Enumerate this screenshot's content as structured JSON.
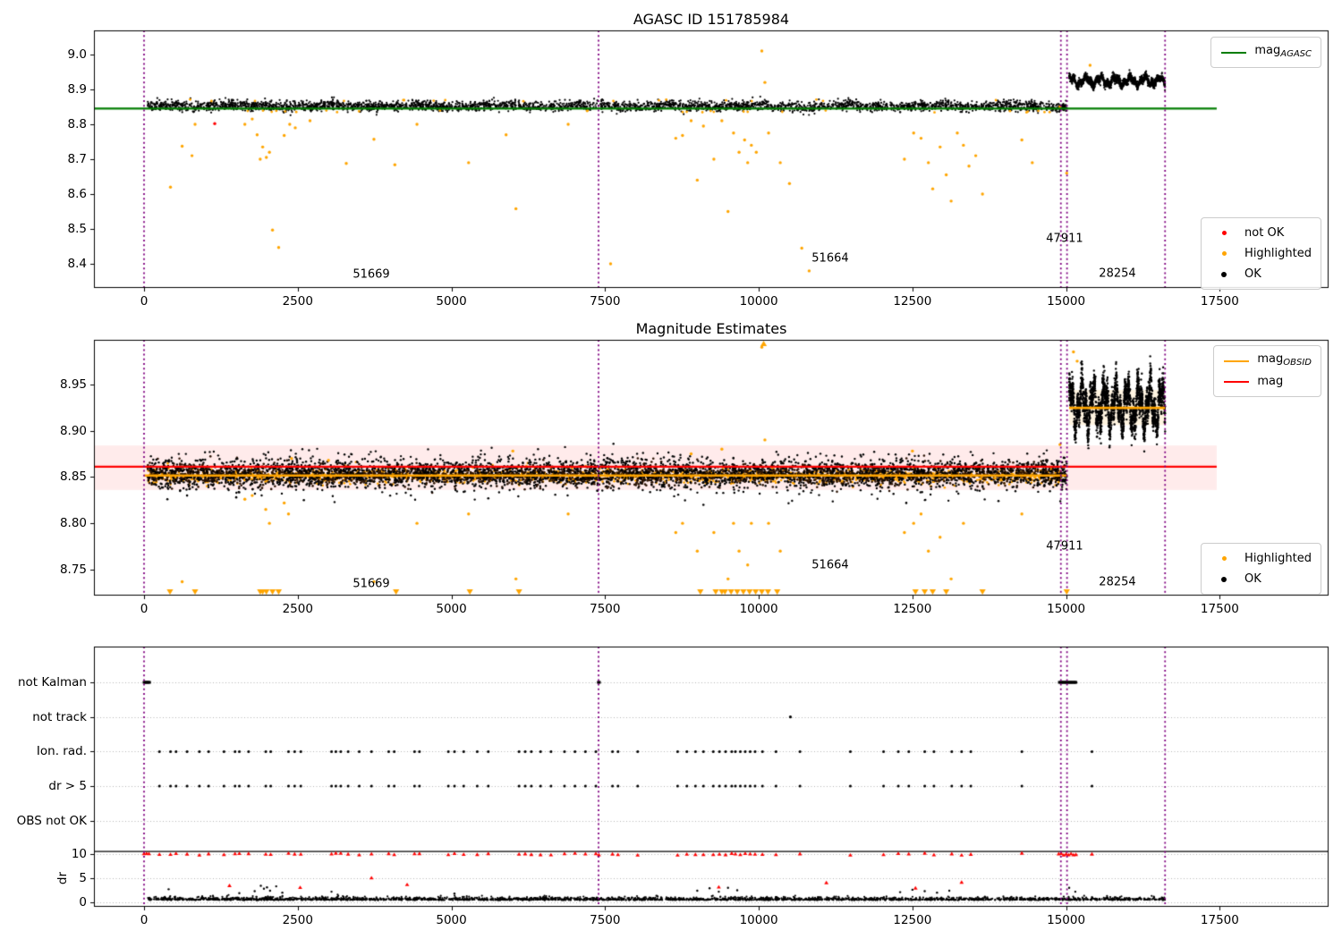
{
  "colors": {
    "agasc_line": "#007d00",
    "vline": "#800080",
    "highlighted": "#ffa500",
    "not_ok": "#ff0000",
    "ok": "#000000",
    "mag_line": "#ff0000",
    "obsid_line": "#ffa500",
    "mag_band_fill": "rgba(255,0,0,0.08)",
    "obsid_band_fill": "rgba(255,165,0,0.12)",
    "band_core": "#2a1203",
    "grid": "#b5b5b5",
    "spine": "#000000"
  },
  "chart_data": [
    {
      "type": "scatter",
      "title": "AGASC ID 151785984",
      "xlim": [
        -815,
        19270
      ],
      "ylim": [
        8.331,
        9.069
      ],
      "xticks": [
        0,
        2500,
        5000,
        7500,
        10000,
        12500,
        15000,
        17500
      ],
      "yticks": [
        "8.4",
        "8.5",
        "8.6",
        "8.7",
        "8.8",
        "8.9",
        "9.0"
      ],
      "ytick_values": [
        8.4,
        8.5,
        8.6,
        8.7,
        8.8,
        8.9,
        9.0
      ],
      "legend_line": {
        "prefix": "mag",
        "sub": "AGASC"
      },
      "legend_points": [
        {
          "label": "not OK",
          "color_key": "not_ok"
        },
        {
          "label": "Highlighted",
          "color_key": "highlighted"
        },
        {
          "label": "OK",
          "color_key": "ok"
        }
      ],
      "agasc_mag": 8.845,
      "agasc_line_span": [
        -815,
        17450
      ],
      "vlines": [
        0,
        7394,
        14915,
        15015,
        16610
      ],
      "bands": [
        {
          "x0": 60,
          "x1": 14915,
          "mean": 8.8525,
          "sigma": 0.0072,
          "n": 3200,
          "wave_amp": 0.0035,
          "p1": 1400,
          "p2": 500
        },
        {
          "x0": 14920,
          "x1": 15010,
          "mean": 8.849,
          "sigma": 0.0065,
          "n": 45,
          "wave_amp": 0,
          "p1": 1,
          "p2": 1
        },
        {
          "x0": 15050,
          "x1": 16610,
          "mean": 8.924,
          "sigma": 0.0055,
          "n": 1500,
          "wave_amp": 0.016,
          "p1": 240,
          "p2": 90
        }
      ],
      "edge_orange_n": 45,
      "highlighted_points": [
        [
          430,
          8.62
        ],
        [
          620,
          8.737
        ],
        [
          780,
          8.71
        ],
        [
          830,
          8.8
        ],
        [
          1640,
          8.8
        ],
        [
          1760,
          8.815
        ],
        [
          1840,
          8.77
        ],
        [
          1890,
          8.7
        ],
        [
          1930,
          8.735
        ],
        [
          1990,
          8.705
        ],
        [
          2040,
          8.72
        ],
        [
          2090,
          8.497
        ],
        [
          2190,
          8.447
        ],
        [
          2280,
          8.768
        ],
        [
          2370,
          8.8
        ],
        [
          2460,
          8.79
        ],
        [
          2700,
          8.81
        ],
        [
          3290,
          8.688
        ],
        [
          3740,
          8.757
        ],
        [
          4080,
          8.684
        ],
        [
          4440,
          8.8
        ],
        [
          5280,
          8.69
        ],
        [
          5890,
          8.77
        ],
        [
          6050,
          8.558
        ],
        [
          6900,
          8.8
        ],
        [
          7590,
          8.4
        ],
        [
          8650,
          8.76
        ],
        [
          8760,
          8.768
        ],
        [
          8900,
          8.81
        ],
        [
          9000,
          8.64
        ],
        [
          9100,
          8.795
        ],
        [
          9270,
          8.7
        ],
        [
          9400,
          8.81
        ],
        [
          9500,
          8.55
        ],
        [
          9590,
          8.775
        ],
        [
          9680,
          8.72
        ],
        [
          9770,
          8.755
        ],
        [
          9820,
          8.69
        ],
        [
          9880,
          8.74
        ],
        [
          9960,
          8.72
        ],
        [
          10050,
          9.01
        ],
        [
          10100,
          8.92
        ],
        [
          10160,
          8.775
        ],
        [
          10350,
          8.69
        ],
        [
          10500,
          8.63
        ],
        [
          10700,
          8.445
        ],
        [
          10820,
          8.38
        ],
        [
          12370,
          8.7
        ],
        [
          12520,
          8.775
        ],
        [
          12640,
          8.76
        ],
        [
          12760,
          8.69
        ],
        [
          12830,
          8.615
        ],
        [
          12950,
          8.735
        ],
        [
          13050,
          8.655
        ],
        [
          13130,
          8.58
        ],
        [
          13230,
          8.775
        ],
        [
          13330,
          8.74
        ],
        [
          13420,
          8.68
        ],
        [
          13530,
          8.71
        ],
        [
          13640,
          8.6
        ],
        [
          14280,
          8.755
        ],
        [
          14450,
          8.69
        ],
        [
          14900,
          8.85
        ],
        [
          15010,
          8.66
        ],
        [
          15390,
          8.969
        ]
      ],
      "not_ok_points": [
        [
          1150,
          8.802
        ]
      ],
      "annotations": [
        {
          "text": "51669",
          "x": 3697,
          "y": 8.369
        },
        {
          "text": "51664",
          "x": 11163,
          "y": 8.415
        },
        {
          "text": "47911",
          "x": 14976,
          "y": 8.472
        },
        {
          "text": "28254",
          "x": 15835,
          "y": 8.372
        }
      ]
    },
    {
      "type": "scatter",
      "title": "Magnitude Estimates",
      "xlim": [
        -815,
        19270
      ],
      "ylim": [
        8.722,
        8.998
      ],
      "xticks": [
        0,
        2500,
        5000,
        7500,
        10000,
        12500,
        15000,
        17500
      ],
      "yticks": [
        "8.75",
        "8.80",
        "8.85",
        "8.90",
        "8.95"
      ],
      "ytick_values": [
        8.75,
        8.8,
        8.85,
        8.9,
        8.95
      ],
      "legend_lines": [
        {
          "prefix": "mag",
          "sub": "OBSID",
          "color_key": "obsid_line"
        },
        {
          "prefix": "mag",
          "sub": "",
          "color_key": "mag_line"
        }
      ],
      "legend_points": [
        {
          "label": "Highlighted",
          "color_key": "highlighted"
        },
        {
          "label": "OK",
          "color_key": "ok"
        }
      ],
      "mag": 8.861,
      "mag_line_span": [
        -815,
        17450
      ],
      "mag_band": [
        8.836,
        8.884
      ],
      "obsid_segments": [
        {
          "x0": 0,
          "x1": 15015,
          "y": 8.8515
        },
        {
          "x0": 15050,
          "x1": 16610,
          "y": 8.9245
        }
      ],
      "obsid_band": {
        "x0": 15050,
        "x1": 16610,
        "y0": 8.906,
        "y1": 8.944
      },
      "vlines": [
        0,
        7394,
        14915,
        15015,
        16610
      ],
      "bands": [
        {
          "x0": 60,
          "x1": 14915,
          "mean": 8.851,
          "sigma": 0.004,
          "n": 1600,
          "wave_amp": 0,
          "p1": 1,
          "p2": 1,
          "color_key": "highlighted",
          "r": 1.3
        },
        {
          "x0": 60,
          "x1": 14915,
          "mean": 8.8525,
          "sigma": 0.0055,
          "n": 2800,
          "wave_amp": 0,
          "p1": 1,
          "p2": 1,
          "color_key": "band_core",
          "r": 1.3
        },
        {
          "x0": 60,
          "x1": 14915,
          "mean": 8.854,
          "sigma": 0.0095,
          "n": 2800,
          "wave_amp": 0.002,
          "p1": 1100,
          "p2": 400,
          "color_key": "ok",
          "r": 1.2
        },
        {
          "x0": 14920,
          "x1": 15010,
          "mean": 8.852,
          "sigma": 0.008,
          "n": 45,
          "wave_amp": 0,
          "p1": 1,
          "p2": 1,
          "color_key": "ok",
          "r": 1.2
        },
        {
          "x0": 15050,
          "x1": 16610,
          "mean": 8.927,
          "sigma": 0.008,
          "n": 2300,
          "wave_amp": 0.03,
          "p1": 185,
          "p2": 70,
          "color_key": "ok",
          "r": 1.2
        }
      ],
      "highlighted_points": [
        [
          620,
          8.737
        ],
        [
          1640,
          8.826
        ],
        [
          1760,
          8.83
        ],
        [
          1980,
          8.815
        ],
        [
          2040,
          8.8
        ],
        [
          2280,
          8.822
        ],
        [
          2350,
          8.81
        ],
        [
          2400,
          8.87
        ],
        [
          3000,
          8.868
        ],
        [
          3740,
          8.737
        ],
        [
          4440,
          8.8
        ],
        [
          5280,
          8.81
        ],
        [
          6000,
          8.878
        ],
        [
          6050,
          8.74
        ],
        [
          6900,
          8.81
        ],
        [
          8650,
          8.79
        ],
        [
          8760,
          8.8
        ],
        [
          8900,
          8.875
        ],
        [
          9000,
          8.77
        ],
        [
          9270,
          8.79
        ],
        [
          9400,
          8.88
        ],
        [
          9500,
          8.74
        ],
        [
          9590,
          8.8
        ],
        [
          9680,
          8.77
        ],
        [
          9820,
          8.755
        ],
        [
          9880,
          8.8
        ],
        [
          10050,
          8.99
        ],
        [
          10100,
          8.89
        ],
        [
          10160,
          8.8
        ],
        [
          10350,
          8.77
        ],
        [
          12370,
          8.79
        ],
        [
          12500,
          8.878
        ],
        [
          12520,
          8.8
        ],
        [
          12640,
          8.81
        ],
        [
          12760,
          8.77
        ],
        [
          12950,
          8.785
        ],
        [
          13130,
          8.74
        ],
        [
          13330,
          8.8
        ],
        [
          14280,
          8.81
        ],
        [
          14900,
          8.885
        ],
        [
          15120,
          8.985
        ],
        [
          15180,
          8.975
        ]
      ],
      "black_low_points": [
        [
          380,
          8.826
        ],
        [
          700,
          8.83
        ],
        [
          1500,
          8.828
        ],
        [
          2600,
          8.825
        ],
        [
          5600,
          8.827
        ],
        [
          9100,
          8.82
        ],
        [
          12400,
          8.822
        ],
        [
          13900,
          8.824
        ]
      ],
      "clip_bottom_x": [
        422,
        830,
        1890,
        1930,
        1990,
        2090,
        2190,
        4100,
        5300,
        6100,
        9050,
        9300,
        9400,
        9450,
        9550,
        9650,
        9750,
        9850,
        9950,
        10050,
        10150,
        10300,
        12550,
        12700,
        12830,
        13050,
        13640,
        15010
      ],
      "clip_top_x": [
        10080
      ],
      "annotations": [
        {
          "text": "51669",
          "x": 3697,
          "y": 8.735
        },
        {
          "text": "51664",
          "x": 11163,
          "y": 8.755
        },
        {
          "text": "47911",
          "x": 14976,
          "y": 8.775
        },
        {
          "text": "28254",
          "x": 15835,
          "y": 8.736
        }
      ]
    },
    {
      "type": "scatter",
      "title": "",
      "xlim": [
        -815,
        19270
      ],
      "xticks": [
        0,
        2500,
        5000,
        7500,
        10000,
        12500,
        15000,
        17500
      ],
      "categories": [
        "not Kalman",
        "not track",
        "Ion. rad.",
        "dr > 5",
        "OBS not OK"
      ],
      "dr_ticks": [
        "10",
        "5",
        "0"
      ],
      "dr_tick_values": [
        10,
        5,
        0
      ],
      "ylabel": "dr",
      "vlines": [
        0,
        7394,
        14915,
        15015,
        16610
      ],
      "clip_hline": 10.5,
      "not_kalman_runs": [
        [
          0,
          90
        ],
        [
          7390,
          7425
        ],
        [
          14890,
          15170
        ]
      ],
      "not_track_x": [
        10515
      ],
      "flag_event_x": [
        250,
        430,
        520,
        700,
        900,
        1050,
        1300,
        1480,
        1550,
        1700,
        1980,
        2060,
        2350,
        2450,
        2550,
        3050,
        3120,
        3200,
        3320,
        3500,
        3700,
        3980,
        4070,
        4400,
        4480,
        4950,
        5050,
        5200,
        5420,
        5600,
        6100,
        6200,
        6300,
        6450,
        6620,
        6840,
        7010,
        7180,
        7350,
        7620,
        7710,
        8030,
        8680,
        8830,
        8970,
        9100,
        9260,
        9360,
        9460,
        9560,
        9620,
        9700,
        9780,
        9860,
        9940,
        10060,
        10280,
        10670,
        11490,
        12030,
        12270,
        12440,
        12700,
        12850,
        13140,
        13300,
        13450,
        14280,
        15420
      ],
      "obs_not_ok_x": [],
      "red_clip_extra_x": [
        0,
        40,
        80,
        7400,
        14880,
        14920,
        14960,
        15000,
        15040,
        15080,
        15120,
        15160
      ],
      "red_mid_points": [
        [
          1390,
          3.5
        ],
        [
          2540,
          3.1
        ],
        [
          3700,
          5.1
        ],
        [
          4280,
          3.7
        ],
        [
          9350,
          3.2
        ],
        [
          11100,
          4.1
        ],
        [
          12550,
          3.0
        ],
        [
          13300,
          4.2
        ]
      ],
      "dr_band": {
        "x0": 60,
        "x1": 16610,
        "n": 2400,
        "base": 0.45
      },
      "dr_black_spikes": [
        [
          400,
          2.7
        ],
        [
          1550,
          1.9
        ],
        [
          1800,
          2.3
        ],
        [
          1900,
          3.4
        ],
        [
          1950,
          2.8
        ],
        [
          2000,
          3.1
        ],
        [
          2050,
          2.4
        ],
        [
          2150,
          3.3
        ],
        [
          2250,
          2.0
        ],
        [
          3050,
          2.2
        ],
        [
          5050,
          1.8
        ],
        [
          9000,
          2.4
        ],
        [
          9200,
          2.9
        ],
        [
          9350,
          2.2
        ],
        [
          9500,
          3.0
        ],
        [
          9650,
          2.5
        ],
        [
          12300,
          2.1
        ],
        [
          12500,
          2.6
        ],
        [
          12700,
          2.3
        ],
        [
          12900,
          2.0
        ],
        [
          13100,
          2.4
        ],
        [
          15050,
          3.0
        ],
        [
          15150,
          2.2
        ]
      ]
    }
  ]
}
